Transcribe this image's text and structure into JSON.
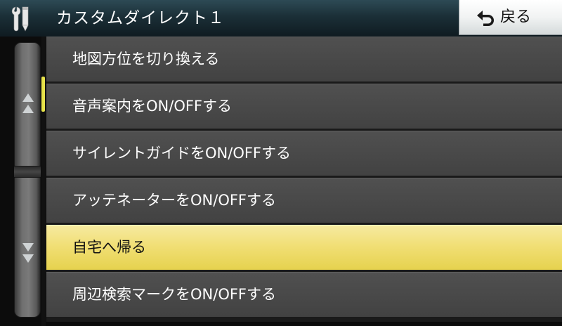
{
  "header": {
    "title": "カスタムダイレクト１",
    "icon": "tools-icon",
    "back_button": {
      "label": "戻る",
      "icon": "back-arrow-icon"
    }
  },
  "scroll": {
    "up_icon": "scroll-up-double-arrow-icon",
    "down_icon": "scroll-down-double-arrow-icon",
    "thumb_color": "#e6e24a"
  },
  "menu": {
    "items": [
      {
        "label": "地図方位を切り換える",
        "selected": false
      },
      {
        "label": "音声案内をON/OFFする",
        "selected": false
      },
      {
        "label": "サイレントガイドをON/OFFする",
        "selected": false
      },
      {
        "label": "アッテネーターをON/OFFする",
        "selected": false
      },
      {
        "label": "自宅へ帰る",
        "selected": true
      },
      {
        "label": "周辺検索マークをON/OFFする",
        "selected": false
      }
    ]
  },
  "colors": {
    "item_bg": "#4a4a4a",
    "selected_bg": "#f1df76",
    "header_bg": "#1b2f37"
  }
}
